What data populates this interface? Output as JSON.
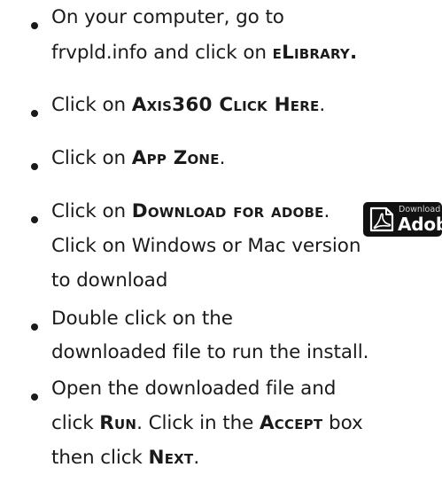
{
  "steps": [
    {
      "lines": [
        [
          "On your computer, go to"
        ],
        [
          "frvpld.info and click on ",
          {
            "sc": "eLibrary."
          }
        ]
      ]
    },
    {
      "lines": [
        [
          "Click on ",
          {
            "sc": "Axis360 Click Here"
          },
          "."
        ]
      ]
    },
    {
      "lines": [
        [
          "Click on ",
          {
            "sc": "App Zone"
          },
          "."
        ]
      ]
    },
    {
      "lines": [
        [
          "Click on ",
          {
            "sc": "Download for adobe"
          },
          "."
        ],
        [
          "Click on  Windows or Mac version"
        ],
        [
          "to download"
        ]
      ]
    },
    {
      "lines": [
        [
          "Double click on the"
        ],
        [
          "downloaded file to run the install."
        ]
      ]
    },
    {
      "lines": [
        [
          "Open the downloaded file and"
        ],
        [
          "click ",
          {
            "sc": "Run"
          },
          ".  Click in the ",
          {
            "sc": "Accept"
          },
          " box"
        ],
        [
          "then click ",
          {
            "sc": "Next"
          },
          "."
        ]
      ]
    }
  ],
  "download_badge": {
    "small_text": "Download for",
    "big_text": "Adobe",
    "icon": "pdf-document-icon",
    "background": "#111111"
  }
}
